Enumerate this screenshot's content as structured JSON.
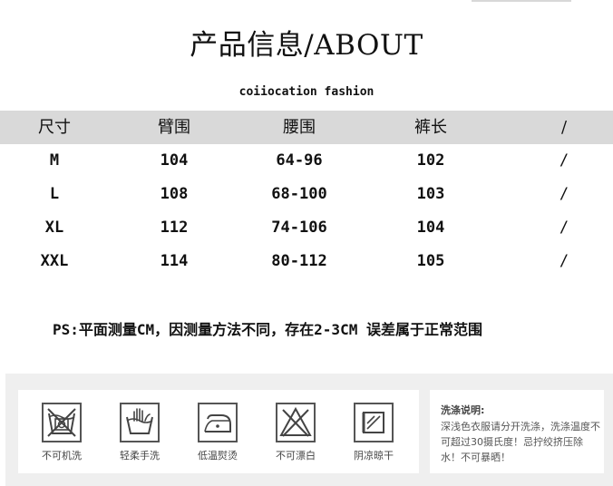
{
  "header": {
    "title": "产品信息/ABOUT",
    "subtitle": "coiiocation fashion"
  },
  "size_table": {
    "columns": [
      "尺寸",
      "臂围",
      "腰围",
      "裤长",
      "/"
    ],
    "rows": [
      [
        "M",
        "104",
        "64-96",
        "102",
        "/"
      ],
      [
        "L",
        "108",
        "68-100",
        "103",
        "/"
      ],
      [
        "XL",
        "112",
        "74-106",
        "104",
        "/"
      ],
      [
        "XXL",
        "114",
        "80-112",
        "105",
        "/"
      ]
    ]
  },
  "note": "PS:平面测量CM，因测量方法不同，存在2-3CM 误差属于正常范围",
  "care": {
    "icons": [
      {
        "icon": "no-machine-wash-icon",
        "label": "不可机洗"
      },
      {
        "icon": "gentle-hand-wash-icon",
        "label": "轻柔手洗"
      },
      {
        "icon": "low-temp-iron-icon",
        "label": "低温熨烫"
      },
      {
        "icon": "no-bleach-icon",
        "label": "不可漂白"
      },
      {
        "icon": "shade-dry-icon",
        "label": "阴凉晾干"
      }
    ],
    "instructions_title": "洗涤说明:",
    "instructions_text": "深浅色衣服请分开洗涤，洗涤温度不可超过30摄氏度！忌拧绞挤压除水！不可暴晒！"
  }
}
